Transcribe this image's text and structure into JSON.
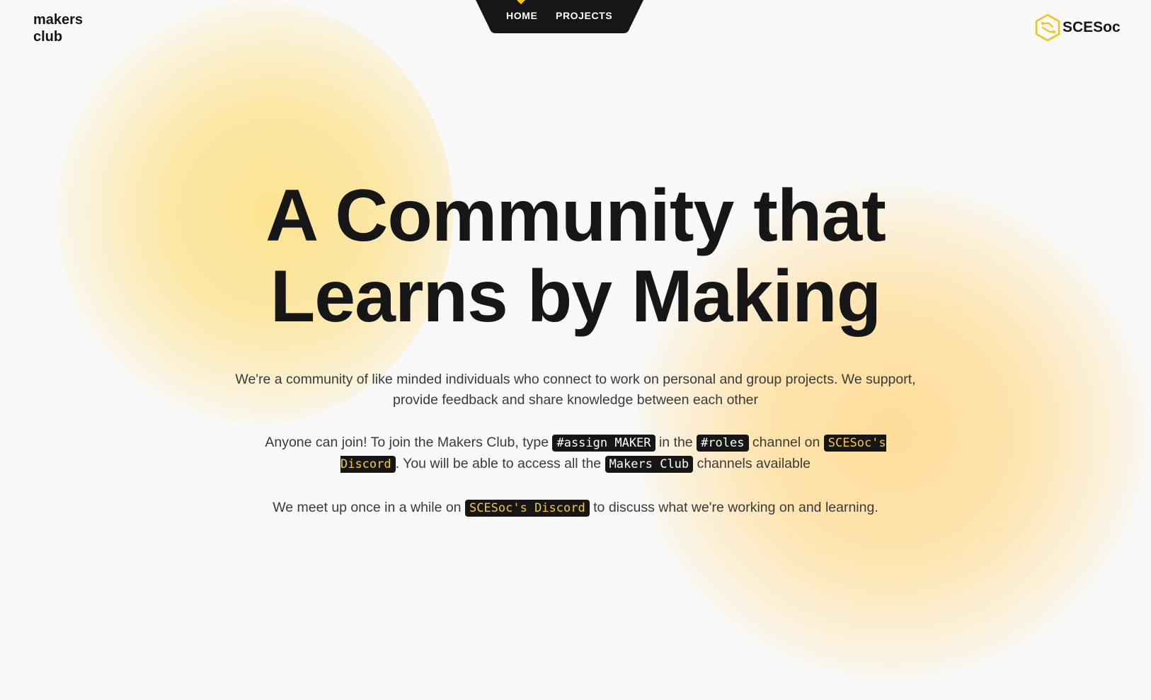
{
  "brand": {
    "line1": "makers",
    "line2": "club"
  },
  "nav": {
    "items": [
      {
        "label": "HOME"
      },
      {
        "label": "PROJECTS"
      }
    ]
  },
  "logo": {
    "text": "SCESoc",
    "icon": "hexagon-circuit-icon",
    "accent_color": "#f0c419"
  },
  "hero": {
    "title_line1": "A Community that",
    "title_line2": "Learns by Making"
  },
  "intro": {
    "text": "We're a community of like minded individuals who connect to work on personal and group projects. We support, provide feedback and share knowledge between each other"
  },
  "join": {
    "text1": "Anyone can join! To join the Makers Club, type ",
    "code_assign": "#assign MAKER",
    "text2": " in the ",
    "code_roles": "#roles",
    "text3": " channel on ",
    "discord_link": "SCESoc's Discord",
    "text4": ". You will be able to access all the ",
    "code_makers": "Makers Club",
    "text5": " channels available"
  },
  "meetup": {
    "text1": "We meet up once in a while on ",
    "discord_link": "SCESoc's Discord",
    "text2": " to discuss what we're working on and learning."
  },
  "colors": {
    "background": "#f9f9f9",
    "text": "#161616",
    "code_bg": "#161616",
    "discord_link": "#f3c83d",
    "blob_yellow": "#fde28c",
    "blob_peach": "#ffdc96"
  }
}
